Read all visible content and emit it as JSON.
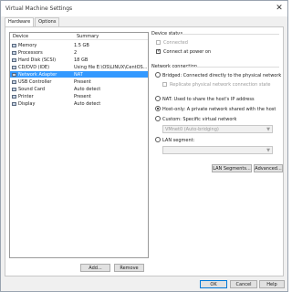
{
  "window": {
    "title": "Virtual Machine Settings",
    "close_glyph": "✕"
  },
  "tabs": [
    {
      "label": "Hardware"
    },
    {
      "label": "Options"
    }
  ],
  "device_list": {
    "headers": {
      "device": "Device",
      "summary": "Summary"
    },
    "rows": [
      {
        "device": "Memory",
        "summary": "1.5 GB",
        "icon": "memory-icon"
      },
      {
        "device": "Processors",
        "summary": "2",
        "icon": "processor-icon"
      },
      {
        "device": "Hard Disk (SCSI)",
        "summary": "18 GB",
        "icon": "hard-disk-icon"
      },
      {
        "device": "CD/DVD (IDE)",
        "summary": "Using file E:\\OS\\LINUX\\CentOS...",
        "icon": "cd-dvd-icon"
      },
      {
        "device": "Network Adapter",
        "summary": "NAT",
        "icon": "network-adapter-icon"
      },
      {
        "device": "USB Controller",
        "summary": "Present",
        "icon": "usb-icon"
      },
      {
        "device": "Sound Card",
        "summary": "Auto detect",
        "icon": "sound-card-icon"
      },
      {
        "device": "Printer",
        "summary": "Present",
        "icon": "printer-icon"
      },
      {
        "device": "Display",
        "summary": "Auto detect",
        "icon": "display-icon"
      }
    ]
  },
  "device_status": {
    "title": "Device status",
    "connected": {
      "label": "Connected",
      "checked": false
    },
    "connect_at_power_on": {
      "label": "Connect at power on",
      "checked": true
    }
  },
  "network_connection": {
    "title": "Network connection",
    "bridged": "Bridged: Connected directly to the physical network",
    "replicate": "Replicate physical network connection state",
    "nat": "NAT: Used to share the host's IP address",
    "host_only": "Host-only: A private network shared with the host",
    "custom": "Custom: Specific virtual network",
    "custom_select_value": "VMnet0 (Auto-bridging)",
    "lan_segment": "LAN segment:",
    "selected": "host_only"
  },
  "buttons": {
    "lan_segments": "LAN Segments...",
    "advanced": "Advanced...",
    "add": "Add...",
    "remove": "Remove",
    "ok": "OK",
    "cancel": "Cancel",
    "help": "Help"
  },
  "colors": {
    "selection": "#3399ff",
    "accent": "#0078d7"
  }
}
